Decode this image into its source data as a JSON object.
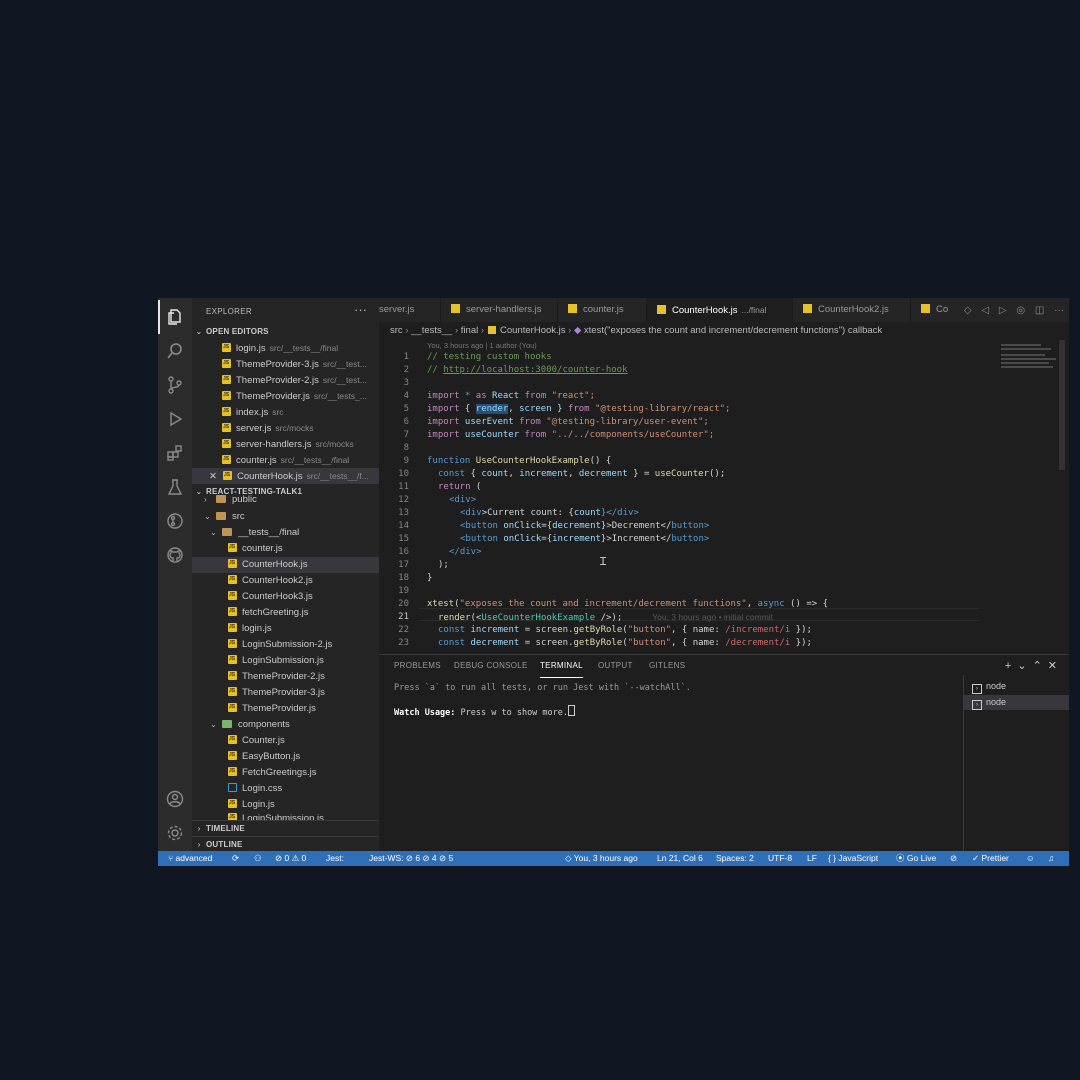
{
  "sidebar": {
    "title": "EXPLORER",
    "open_editors_label": "OPEN EDITORS",
    "open_editors": [
      {
        "name": "login.js",
        "path": "src/__tests__/final"
      },
      {
        "name": "ThemeProvider-3.js",
        "path": "src/__test..."
      },
      {
        "name": "ThemeProvider-2.js",
        "path": "src/__test..."
      },
      {
        "name": "ThemeProvider.js",
        "path": "src/__tests_..."
      },
      {
        "name": "index.js",
        "path": "src"
      },
      {
        "name": "server.js",
        "path": "src/mocks"
      },
      {
        "name": "server-handlers.js",
        "path": "src/mocks"
      },
      {
        "name": "counter.js",
        "path": "src/__tests__/final"
      },
      {
        "name": "CounterHook.js",
        "path": "src/__tests__/f..."
      }
    ],
    "project_label": "REACT-TESTING-TALK1",
    "tree": {
      "public": "public",
      "src": "src",
      "tests_folder": "__tests__/final",
      "test_files": [
        "counter.js",
        "CounterHook.js",
        "CounterHook2.js",
        "CounterHook3.js",
        "fetchGreeting.js",
        "login.js",
        "LoginSubmission-2.js",
        "LoginSubmission.js",
        "ThemeProvider-2.js",
        "ThemeProvider-3.js",
        "ThemeProvider.js"
      ],
      "components_folder": "components",
      "component_files": [
        "Counter.js",
        "EasyButton.js",
        "FetchGreetings.js",
        "Login.css",
        "Login.js",
        "LoginSubmission.js"
      ]
    },
    "timeline_label": "TIMELINE",
    "outline_label": "OUTLINE"
  },
  "tabs": [
    {
      "label": "server.js"
    },
    {
      "label": "server-handlers.js"
    },
    {
      "label": "counter.js"
    },
    {
      "label": "CounterHook.js",
      "sub": ".../final"
    },
    {
      "label": "CounterHook2.js"
    },
    {
      "label": "Co"
    }
  ],
  "breadcrumb": {
    "parts": [
      "src",
      "__tests__",
      "final"
    ],
    "file": "CounterHook.js",
    "symbol": "xtest(\"exposes the count and increment/decrement functions\") callback"
  },
  "editor": {
    "blame_header": "You, 3 hours ago | 1 author (You)",
    "line_numbers": [
      "1",
      "2",
      "3",
      "4",
      "5",
      "6",
      "7",
      "8",
      "9",
      "10",
      "11",
      "12",
      "13",
      "14",
      "15",
      "16",
      "17",
      "18",
      "19",
      "20",
      "21",
      "22",
      "23"
    ],
    "current_line": "21",
    "inline_blame": "You, 3 hours ago • initial commit",
    "lines": {
      "l1": "// testing custom hooks",
      "l2a": "// ",
      "l2b": "http://localhost:3000/counter-hook",
      "l4": [
        "import",
        " * ",
        "as",
        " React ",
        "from",
        " \"react\";"
      ],
      "l5": [
        "import",
        " { ",
        "render",
        ", screen } ",
        "from",
        " \"@testing-library/react\";"
      ],
      "l6": [
        "import",
        " userEvent ",
        "from",
        " \"@testing-library/user-event\";"
      ],
      "l7": [
        "import",
        " useCounter ",
        "from",
        " \"../../components/useCounter\";"
      ],
      "l9": [
        "function",
        " ",
        "UseCounterHookExample",
        "() {"
      ],
      "l10": [
        "const",
        " { ",
        "count",
        ", ",
        "increment",
        ", ",
        "decrement",
        " } = ",
        "useCounter",
        "();"
      ],
      "l11": [
        "return",
        " ("
      ],
      "l12": [
        "<",
        "div",
        ">"
      ],
      "l13": [
        "<",
        "div",
        ">Current count: {",
        "count",
        "}</",
        "div",
        ">"
      ],
      "l14": [
        "<",
        "button",
        " ",
        "onClick",
        "={",
        "decrement",
        "}>Decrement</",
        "button",
        ">"
      ],
      "l15": [
        "<",
        "button",
        " ",
        "onClick",
        "={",
        "increment",
        "}>Increment</",
        "button",
        ">"
      ],
      "l16": [
        "</",
        "div",
        ">"
      ],
      "l17": ");",
      "l18": "}",
      "l20": [
        "xtest",
        "(",
        "\"exposes the count and increment/decrement functions\"",
        ", ",
        "async",
        " () => {"
      ],
      "l21": [
        "render",
        "(<",
        "UseCounterHookExample",
        " />);"
      ],
      "l22": [
        "const",
        " ",
        "increment",
        " = screen.",
        "getByRole",
        "(",
        "\"button\"",
        ", { name: ",
        "/increment/i",
        " });"
      ],
      "l23": [
        "const",
        " ",
        "decrement",
        " = screen.",
        "getByRole",
        "(",
        "\"button\"",
        ", { name: ",
        "/decrement/i",
        " });"
      ]
    }
  },
  "panel": {
    "tabs": [
      "PROBLEMS",
      "DEBUG CONSOLE",
      "TERMINAL",
      "OUTPUT",
      "GITLENS"
    ],
    "active_tab": "TERMINAL",
    "lines": [
      "Press `a` to run all tests, or run Jest with `--watchAll`."
    ],
    "watch_label": "Watch Usage:",
    "watch_text": " Press w to show more.",
    "terminals": [
      "node",
      "node"
    ]
  },
  "status": {
    "branch": "advanced",
    "problems": "⊘ 0 ⚠ 0",
    "jest": "Jest:",
    "jest_ws": "Jest-WS: ⊘ 6 ⊘ 4 ⊘ 5",
    "blame": "You, 3 hours ago",
    "position": "Ln 21, Col 6",
    "spaces": "Spaces: 2",
    "encoding": "UTF-8",
    "eol": "LF",
    "language": "{ } JavaScript",
    "golive": "Go Live",
    "prettier": "✓ Prettier"
  },
  "colors": {
    "status_bar": "#2f6fb8",
    "page_background": "#111722"
  }
}
